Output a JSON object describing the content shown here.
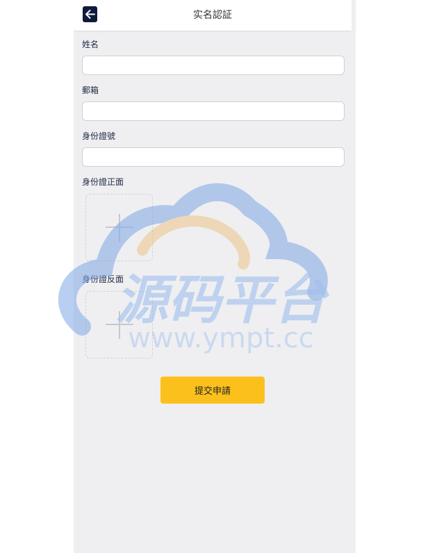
{
  "header": {
    "title": "实名認証",
    "back_icon": "arrow-left-icon"
  },
  "form": {
    "fields": [
      {
        "label": "姓名",
        "value": "",
        "placeholder": ""
      },
      {
        "label": "郵箱",
        "value": "",
        "placeholder": ""
      },
      {
        "label": "身份證號",
        "value": "",
        "placeholder": ""
      }
    ],
    "uploads": [
      {
        "label": "身份證正面",
        "icon": "plus-icon"
      },
      {
        "label": "身份證反面",
        "icon": "plus-icon"
      }
    ],
    "submit_label": "提交申請"
  },
  "watermark": {
    "text": "源码平台",
    "url": "www.ympt.cc"
  },
  "colors": {
    "header_bg": "#ffffff",
    "page_bg": "#efeff1",
    "back_button": "#0f1b3c",
    "submit_button": "#fcc01c",
    "watermark_blue": "#aac8ee",
    "watermark_orange": "#f3d8a8"
  }
}
